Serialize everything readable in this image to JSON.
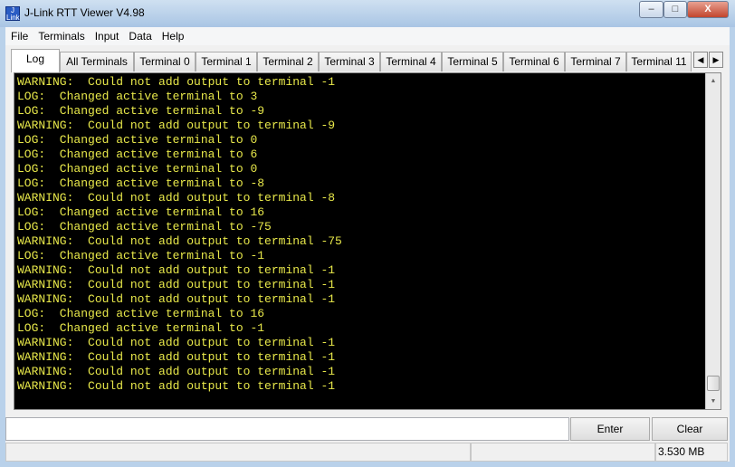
{
  "window": {
    "title": "J-Link RTT Viewer V4.98",
    "minimize": "–",
    "maximize": "□",
    "close": "X",
    "icon": "jlink-logo"
  },
  "menu": [
    "File",
    "Terminals",
    "Input",
    "Data",
    "Help"
  ],
  "tabs": [
    "Log",
    "All Terminals",
    "Terminal 0",
    "Terminal 1",
    "Terminal 2",
    "Terminal 3",
    "Terminal 4",
    "Terminal 5",
    "Terminal 6",
    "Terminal 7",
    "Terminal 11"
  ],
  "active_tab": "Log",
  "log_lines": [
    "WARNING:  Could not add output to terminal -1",
    "LOG:  Changed active terminal to 3",
    "LOG:  Changed active terminal to -9",
    "WARNING:  Could not add output to terminal -9",
    "LOG:  Changed active terminal to 0",
    "LOG:  Changed active terminal to 6",
    "LOG:  Changed active terminal to 0",
    "LOG:  Changed active terminal to -8",
    "WARNING:  Could not add output to terminal -8",
    "LOG:  Changed active terminal to 16",
    "LOG:  Changed active terminal to -75",
    "WARNING:  Could not add output to terminal -75",
    "LOG:  Changed active terminal to -1",
    "WARNING:  Could not add output to terminal -1",
    "WARNING:  Could not add output to terminal -1",
    "WARNING:  Could not add output to terminal -1",
    "LOG:  Changed active terminal to 16",
    "LOG:  Changed active terminal to -1",
    "WARNING:  Could not add output to terminal -1",
    "WARNING:  Could not add output to terminal -1",
    "WARNING:  Could not add output to terminal -1",
    "WARNING:  Could not add output to terminal -1"
  ],
  "input": {
    "value": "",
    "enter_label": "Enter",
    "clear_label": "Clear"
  },
  "status": {
    "memory": "3.530 MB"
  },
  "colors": {
    "terminal_bg": "#000000",
    "terminal_text": "#e8e84a"
  }
}
